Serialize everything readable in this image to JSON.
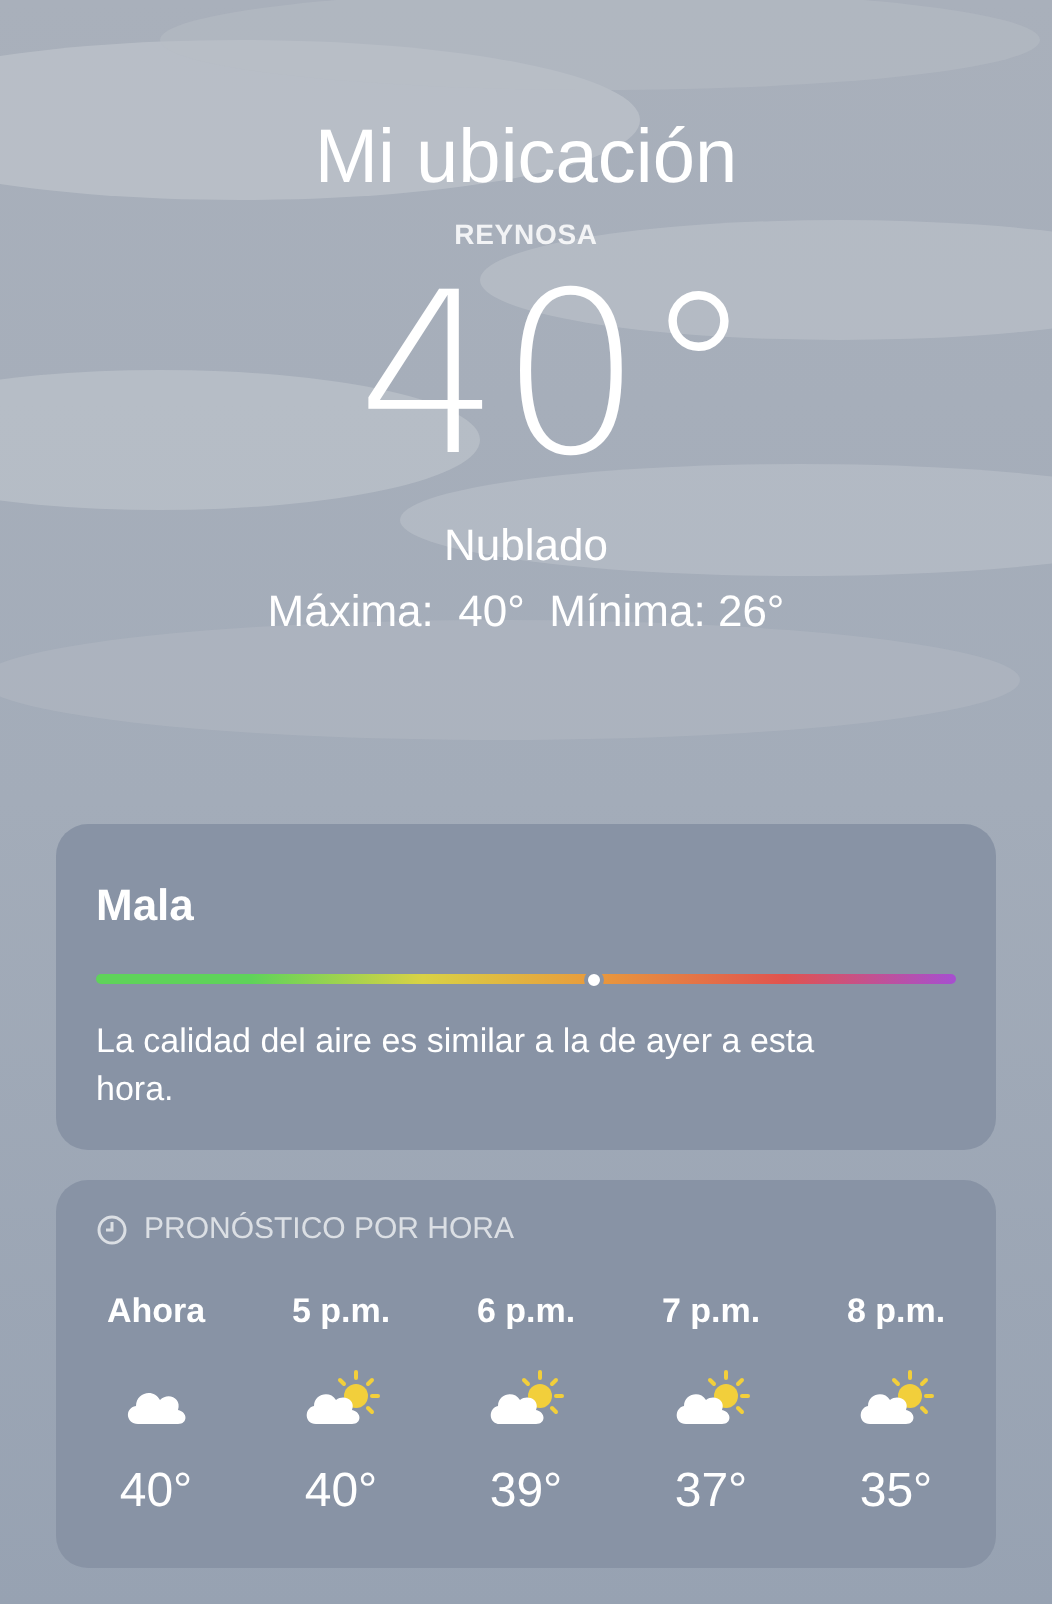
{
  "header": {
    "title": "Mi ubicación",
    "city": "REYNOSA",
    "temperature": "40°",
    "condition": "Nublado",
    "high_low": "Máxima:  40°  Mínima: 26°"
  },
  "air_quality": {
    "label": "Mala",
    "level": 0.58,
    "description": "La calidad del aire es similar a la de ayer a esta hora."
  },
  "hourly": {
    "title": "PRONÓSTICO POR HORA",
    "items": [
      {
        "time": "Ahora",
        "kind": "cloud",
        "temp": "40°"
      },
      {
        "time": "5 p.m.",
        "kind": "partly_sunny",
        "temp": "40°"
      },
      {
        "time": "6 p.m.",
        "kind": "partly_sunny",
        "temp": "39°"
      },
      {
        "time": "7 p.m.",
        "kind": "partly_sunny",
        "temp": "37°"
      },
      {
        "time": "8 p.m.",
        "kind": "partly_sunny",
        "temp": "35°"
      }
    ]
  }
}
